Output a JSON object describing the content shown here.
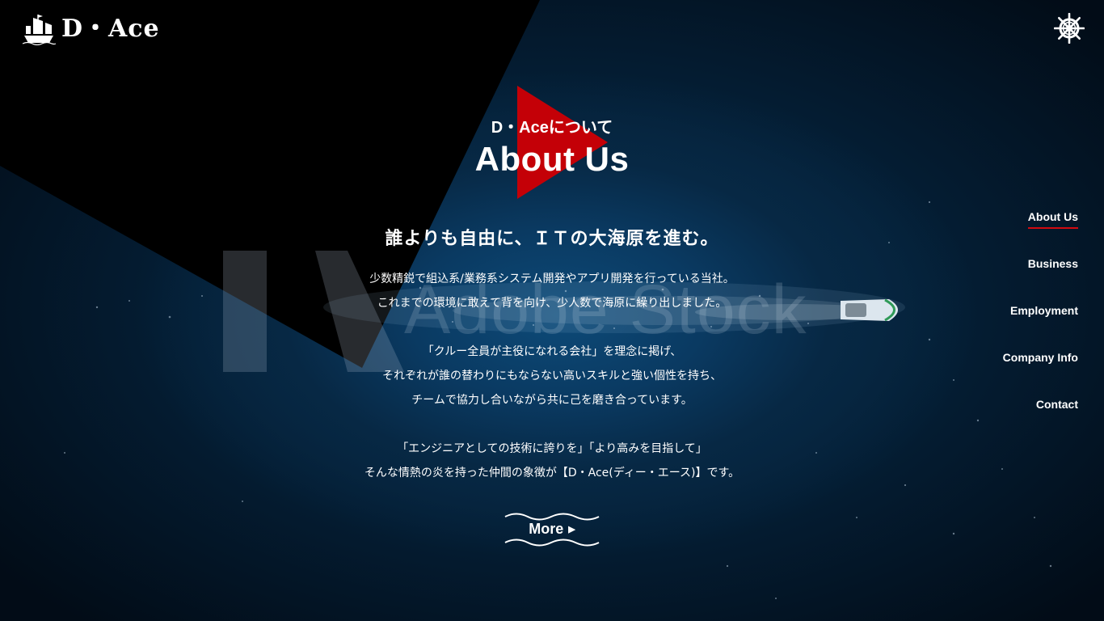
{
  "brand": {
    "logo_text": "D・Ace",
    "icon": "ship-icon"
  },
  "header": {
    "menu_icon": "ships-wheel-icon"
  },
  "section": {
    "subtitle": "D・Aceについて",
    "title": "About Us",
    "tagline": "誰よりも自由に、ＩＴの大海原を進む。",
    "paragraphs": [
      [
        "少数精鋭で組込系/業務系システム開発やアプリ開発を行っている当社。",
        "これまでの環境に敢えて背を向け、少人数で海原に繰り出しました。"
      ],
      [
        "「クルー全員が主役になれる会社」を理念に掲げ、",
        "それぞれが誰の替わりにもならない高いスキルと強い個性を持ち、",
        "チームで協力し合いながら共に己を磨き合っています。"
      ],
      [
        "「エンジニアとしての技術に誇りを」「より高みを目指して」",
        "そんな情熱の炎を持った仲間の象徴が【D・Ace(ディー・エース)】です。"
      ]
    ],
    "more_label": "More",
    "more_icon": "play-triangle-icon"
  },
  "watermark": {
    "text": "Adobe Stock"
  },
  "nav": {
    "items": [
      {
        "label": "About Us",
        "active": true
      },
      {
        "label": "Business",
        "active": false
      },
      {
        "label": "Employment",
        "active": false
      },
      {
        "label": "Company Info",
        "active": false
      },
      {
        "label": "Contact",
        "active": false
      }
    ]
  },
  "colors": {
    "accent": "#d10a10",
    "background": "#041d33",
    "dark_overlay": "#000000",
    "text": "#ffffff"
  }
}
